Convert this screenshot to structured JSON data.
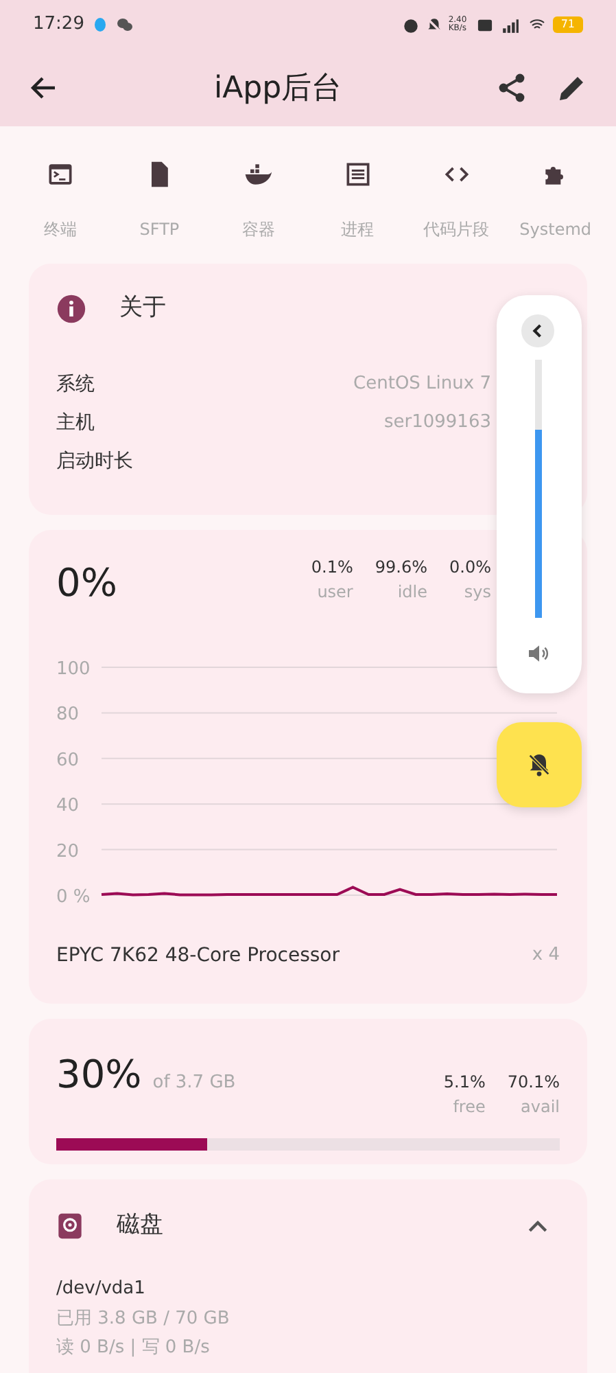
{
  "status_bar": {
    "time": "17:29",
    "network_speed": "2.40 KB/s",
    "battery": "71"
  },
  "app_bar": {
    "title": "iApp后台"
  },
  "tools": [
    {
      "label": "终端",
      "kind": "terminal"
    },
    {
      "label": "SFTP",
      "kind": "file"
    },
    {
      "label": "容器",
      "kind": "whale"
    },
    {
      "label": "进程",
      "kind": "list"
    },
    {
      "label": "代码片段",
      "kind": "code"
    },
    {
      "label": "Systemd",
      "kind": "puzzle"
    }
  ],
  "about": {
    "title": "关于",
    "rows": [
      {
        "label": "系统",
        "value": "CentOS Linux 7"
      },
      {
        "label": "主机",
        "value": "ser1099163"
      },
      {
        "label": "启动时长"
      }
    ]
  },
  "cpu": {
    "usage": "0%",
    "stats": [
      {
        "value": "0.1%",
        "label": "user"
      },
      {
        "value": "99.6%",
        "label": "idle"
      },
      {
        "value": "0.0%",
        "label": "sys"
      }
    ],
    "chart_data": {
      "type": "line",
      "grid": true,
      "ylim": [
        0,
        100
      ],
      "yticks": [
        {
          "value": 0,
          "label": "0 %"
        },
        20,
        40,
        60,
        80,
        100
      ],
      "series": [
        {
          "color": "#9c0b55",
          "values": [
            0.3,
            0.8,
            0.2,
            0.3,
            0.8,
            0.2,
            0.2,
            0.2,
            0.3,
            0.3,
            0.3,
            0.3,
            0.3,
            0.3,
            0.3,
            0.3,
            3.5,
            0.3,
            0.3,
            2.5,
            0.3,
            0.3,
            0.6,
            0.3,
            0.3,
            0.5,
            0.3,
            0.5,
            0.3,
            0.3
          ]
        }
      ]
    },
    "processor": "EPYC 7K62 48-Core Processor",
    "cores": "x 4"
  },
  "memory": {
    "usage": "30%",
    "total": "of 3.7 GB",
    "level": 0.3,
    "stats": [
      {
        "value": "5.1%",
        "label": "free"
      },
      {
        "value": "70.1%",
        "label": "avail"
      }
    ]
  },
  "disk": {
    "title": "磁盘",
    "expanded": true,
    "device": "/dev/vda1",
    "used": "已用 3.8 GB / 70 GB",
    "io": "读 0 B/s | 写 0 B/s"
  },
  "volume_panel": {
    "level": 0.73
  }
}
